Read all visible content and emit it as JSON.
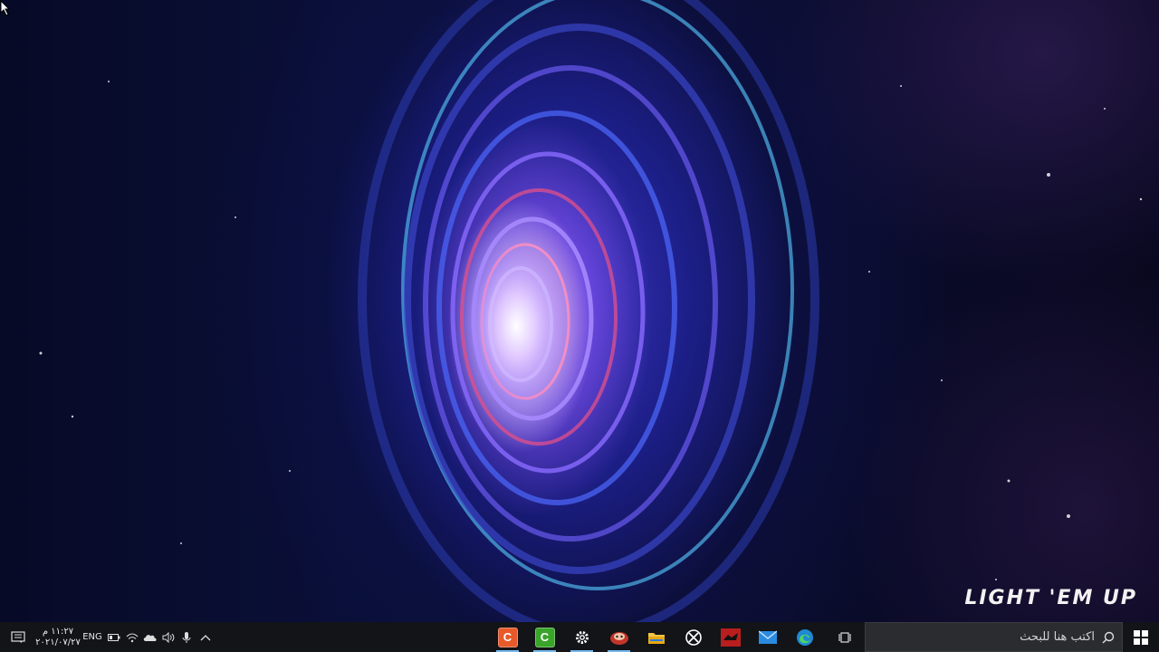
{
  "desktop": {
    "brand_text": "LIGHT 'EM UP"
  },
  "taskbar": {
    "search": {
      "placeholder": "اكتب هنا للبحث",
      "icon": "search-icon"
    },
    "pinned_apps": [
      {
        "name": "orange-app",
        "letter": "C",
        "color": "#e85a2a",
        "active": true
      },
      {
        "name": "green-app",
        "letter": "C",
        "color": "#3aa52a",
        "active": true
      },
      {
        "name": "settings",
        "icon": "gear-icon",
        "active": true
      },
      {
        "name": "game-app",
        "icon": "game-icon",
        "active": true
      },
      {
        "name": "file-explorer",
        "icon": "folder-icon",
        "active": false
      },
      {
        "name": "xbox",
        "icon": "xbox-icon",
        "active": false
      },
      {
        "name": "red-app",
        "icon": "red-app-icon",
        "active": false
      },
      {
        "name": "mail",
        "icon": "mail-icon",
        "active": false
      },
      {
        "name": "edge",
        "icon": "edge-icon",
        "active": false
      }
    ],
    "tray": {
      "language": "ENG",
      "time": "١١:٢٧ م",
      "date": "٢٠٢١/٠٧/٢٧"
    }
  },
  "colors": {
    "taskbar_bg": "#121418",
    "active_indicator": "#76b9ed"
  }
}
